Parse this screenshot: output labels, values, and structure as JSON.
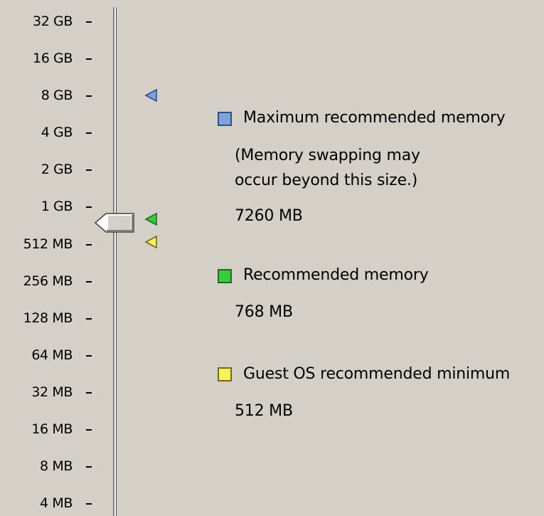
{
  "memory_scale": {
    "ticks": [
      "32 GB",
      "16 GB",
      "8 GB",
      "4 GB",
      "2 GB",
      "1 GB",
      "512 MB",
      "256 MB",
      "128 MB",
      "64 MB",
      "32 MB",
      "16 MB",
      "8 MB",
      "4 MB"
    ],
    "slider_value": "768 MB"
  },
  "legend": {
    "maximum": {
      "label": "Maximum recommended memory",
      "note_line1": "(Memory swapping may",
      "note_line2": "occur beyond this size.)",
      "value": "7260 MB",
      "color": "#7fa3d6"
    },
    "recommended": {
      "label": "Recommended memory",
      "value": "768 MB",
      "color": "#3cc93c"
    },
    "guest_min": {
      "label": "Guest OS recommended minimum",
      "value": "512 MB",
      "color": "#f4f15a"
    }
  }
}
